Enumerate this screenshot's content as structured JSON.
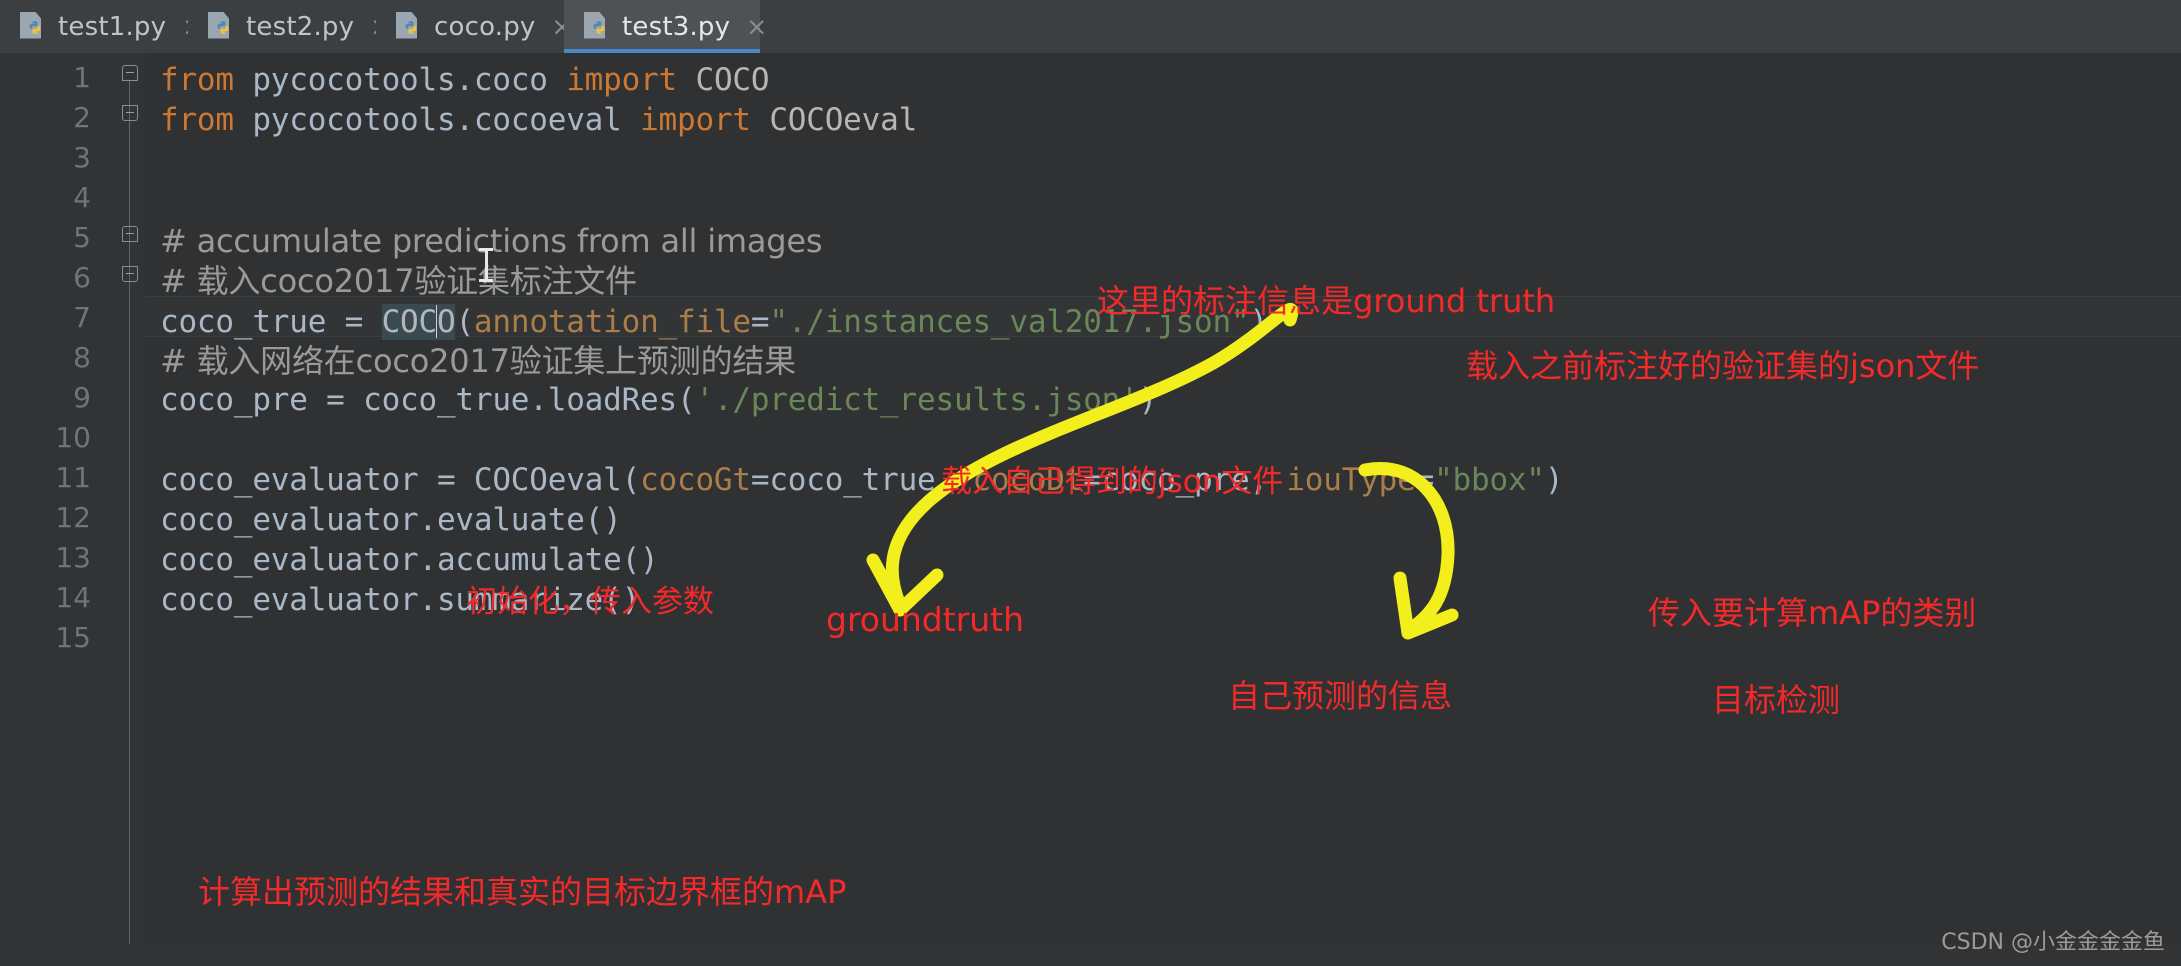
{
  "window": {
    "app": "PyCharm code editor",
    "watermark": "CSDN @小金金金金鱼"
  },
  "tabs": [
    {
      "label": "test1.py",
      "icon": "python-file-icon",
      "close": "×",
      "active": false
    },
    {
      "label": "test2.py",
      "icon": "python-file-icon",
      "close": "×",
      "active": false
    },
    {
      "label": "coco.py",
      "icon": "python-file-icon",
      "close": "×",
      "active": false
    },
    {
      "label": "test3.py",
      "icon": "python-file-icon",
      "close": "×",
      "active": true
    }
  ],
  "gutter": {
    "line_numbers": [
      "1",
      "2",
      "3",
      "4",
      "5",
      "6",
      "7",
      "8",
      "9",
      "10",
      "11",
      "12",
      "13",
      "14",
      "15"
    ]
  },
  "code": {
    "line1_kw_from": "from",
    "line1_module": " pycocotools.coco ",
    "line1_kw_import": "import",
    "line1_name": " COCO",
    "line2_kw_from": "from",
    "line2_module": " pycocotools.cocoeval ",
    "line2_kw_import": "import",
    "line2_name": " COCOeval",
    "line5_comment": "# accumulate predictions from all images",
    "line6_comment": "# 载入coco2017验证集标注文件",
    "line7_a": "coco_true = ",
    "line7_cls_sel": "COC",
    "line7_cls_rest": "O",
    "line7_paren_open": "(",
    "line7_param": "annotation_file",
    "line7_eq": "=",
    "line7_str": "\"./instances_val2017.json\"",
    "line7_paren_close": ")",
    "line8_comment": "# 载入网络在coco2017验证集上预测的结果",
    "line9_a": "coco_pre = coco_true.loadRes(",
    "line9_str": "'./predict_results.json'",
    "line9_close": ")",
    "line11_a": "coco_evaluator = COCOeval(",
    "line11_p1": "cocoGt",
    "line11_v1": "=coco_true, ",
    "line11_p2": "cocoDt",
    "line11_v2": "=coco_pre, ",
    "line11_p3": "iouType",
    "line11_eq3": "=",
    "line11_s3": "\"bbox\"",
    "line11_close": ")",
    "line12": "coco_evaluator.evaluate()",
    "line13": "coco_evaluator.accumulate()",
    "line14": "coco_evaluator.summarize()"
  },
  "annotations": {
    "ground_truth_note": "这里的标注信息是ground truth",
    "load_val_json_note": "载入之前标注好的验证集的json文件",
    "load_own_json_note": "载入自己得到的json文件",
    "init_params_note": "初始化，传入参数",
    "groundtruth_label": "groundtruth",
    "map_category_note": "传入要计算mAP的类别",
    "own_prediction_note": "自己预测的信息",
    "object_detection_note": "目标检测",
    "map_result_note": "计算出预测的结果和真实的目标边界框的mAP"
  },
  "colors": {
    "annotation_red": "#f42a2a",
    "arrow_yellow": "#f2ef1c",
    "keyword_orange": "#cc7832",
    "string_green": "#6a8759",
    "param_tan": "#aa7d49",
    "identifier": "#a9b7c6",
    "tab_active_underline": "#4a88c7",
    "editor_bg": "#2f3133",
    "tabbar_bg": "#3c3f41"
  }
}
